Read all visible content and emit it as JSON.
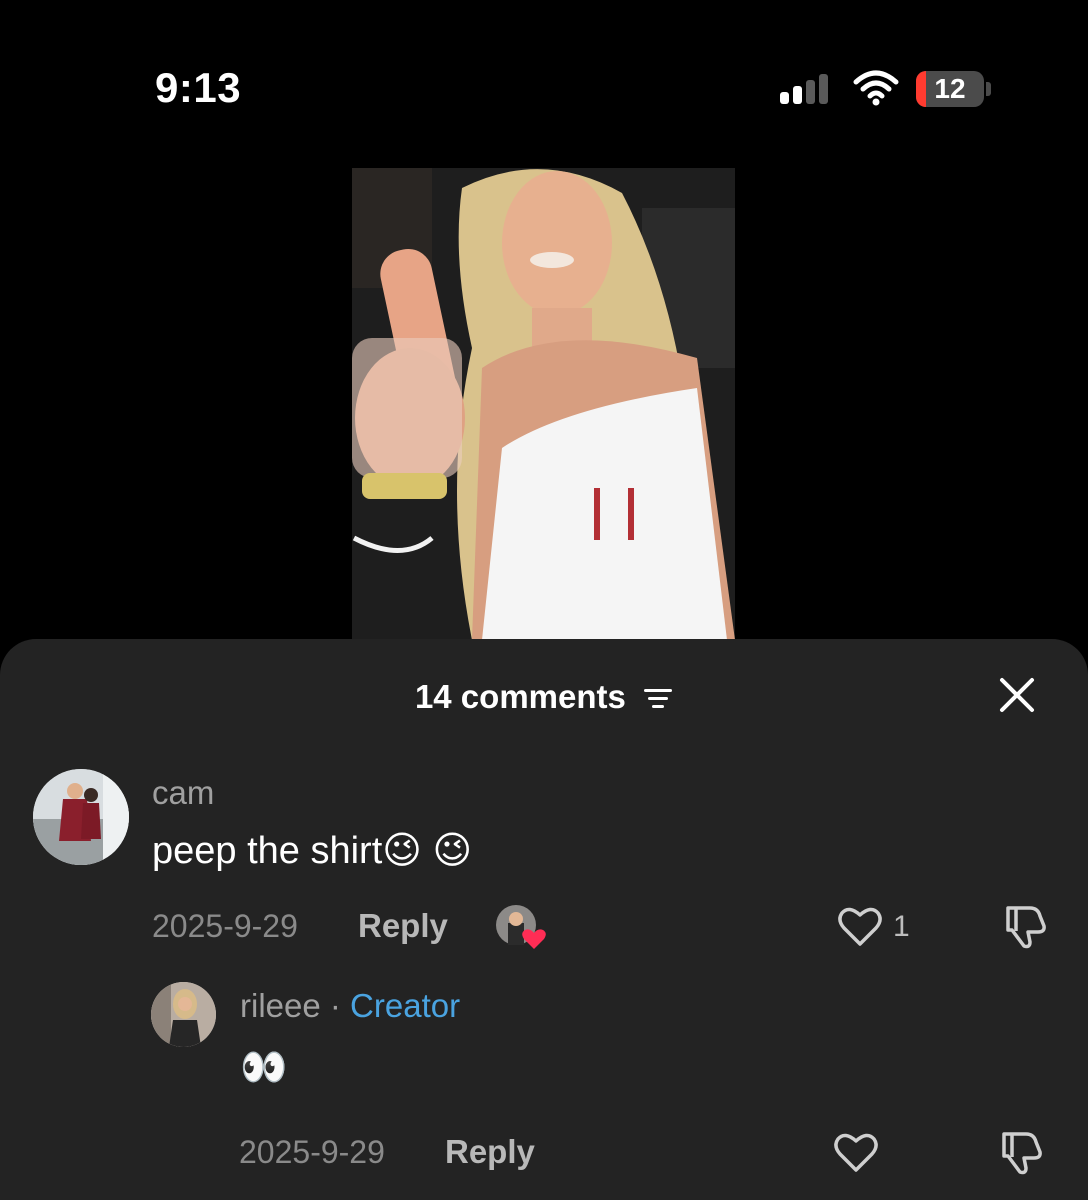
{
  "status_bar": {
    "time": "9:13",
    "battery": "12"
  },
  "sheet": {
    "title": "14 comments"
  },
  "comments": [
    {
      "username": "cam",
      "text": "peep the shirt",
      "emoji": "😉 😉",
      "date": "2025-9-29",
      "reply_label": "Reply",
      "like_count": "1",
      "replies": [
        {
          "username": "rileee",
          "separator": " · ",
          "badge": "Creator",
          "text": "👀",
          "date": "2025-9-29",
          "reply_label": "Reply"
        }
      ]
    }
  ],
  "colors": {
    "sheet_bg": "#232323",
    "creator_badge": "#4aa3e0",
    "heart_badge": "#ff2d55",
    "battery_low": "#ff3b30"
  }
}
